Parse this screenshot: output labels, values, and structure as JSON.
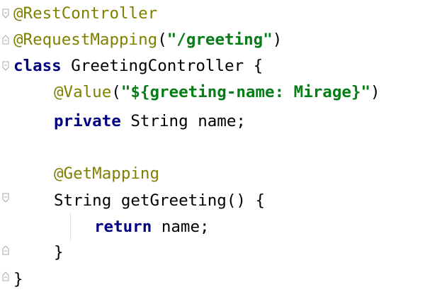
{
  "editor": {
    "lines": {
      "l1": {
        "ann": "@RestController"
      },
      "l2": {
        "ann": "@RequestMapping",
        "open": "(",
        "str": "\"/greeting\"",
        "close": ")"
      },
      "l3": {
        "kw": "class",
        "rest": " GreetingController {"
      },
      "l4": {
        "ann": "@Value",
        "open": "(",
        "str": "\"${greeting-name: Mirage}\"",
        "close": ")"
      },
      "l5": {
        "kw": "private",
        "rest": " String name;"
      },
      "l7": {
        "ann": "@GetMapping"
      },
      "l8": {
        "text": "String getGreeting() {"
      },
      "l9": {
        "kw": "return",
        "rest": " name;"
      },
      "l10": {
        "text": "}"
      },
      "l11": {
        "text": "}"
      }
    },
    "colors": {
      "annotation": "#808000",
      "keyword": "#000080",
      "string": "#067d17",
      "text": "#000000"
    },
    "icons": [
      "fold-open-icon",
      "fold-close-icon",
      "indent-guide"
    ]
  }
}
